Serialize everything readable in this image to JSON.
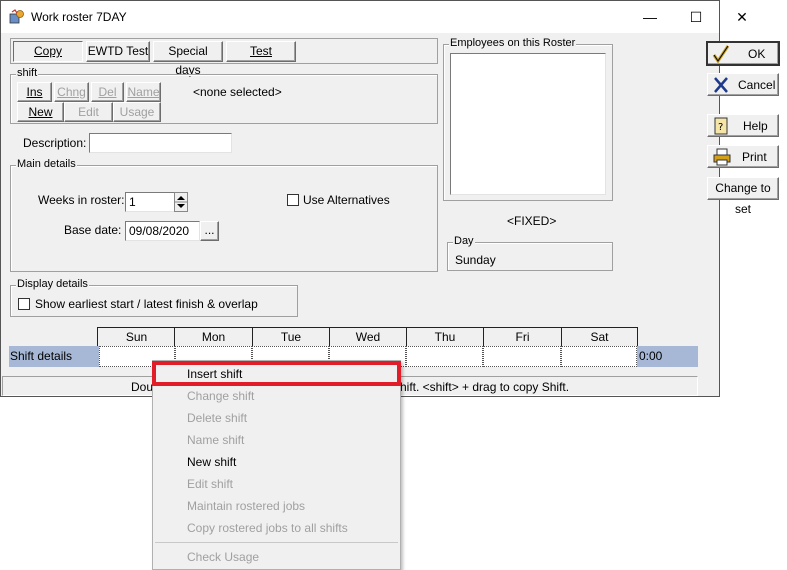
{
  "window": {
    "title": "Work roster  7DAY"
  },
  "titlebar": {
    "minimize": "—",
    "maximize": "☐",
    "close": "✕"
  },
  "tabs": {
    "copy": "Copy",
    "ewtd": "EWTD Test",
    "special_days": "Special days",
    "test": "Test"
  },
  "shift_group": {
    "label": "shift",
    "ins": "Ins",
    "chng": "Chng",
    "del": "Del",
    "name": "Name",
    "new": "New",
    "edit": "Edit",
    "usage": "Usage",
    "selection": "<none selected>"
  },
  "description": {
    "label": "Description:",
    "value": ""
  },
  "main_details": {
    "label": "Main details",
    "weeks_label": "Weeks in roster:",
    "weeks_value": "1",
    "use_alternatives": "Use Alternatives",
    "base_date_label": "Base date:",
    "base_date_value": "09/08/2020",
    "date_btn": "..."
  },
  "employees": {
    "label": "Employees on this Roster",
    "fixed": "<FIXED>"
  },
  "day": {
    "label": "Day",
    "value": "Sunday"
  },
  "display_details": {
    "label": "Display details",
    "show_overlap": "Show earliest start / latest finish & overlap"
  },
  "actions": {
    "ok": "OK",
    "cancel": "Cancel",
    "help": "Help",
    "print": "Print",
    "change_to_set": "Change to set"
  },
  "grid": {
    "days": [
      "Sun",
      "Mon",
      "Tue",
      "Wed",
      "Thu",
      "Fri",
      "Sat"
    ],
    "row_label": "Shift details",
    "total": "0:00"
  },
  "status_bar": {
    "left": "Doub",
    "right": "hift.  <shift> + drag to copy Shift."
  },
  "context_menu": {
    "items": [
      {
        "label": "Insert shift",
        "enabled": true,
        "highlighted": true
      },
      {
        "label": "Change shift",
        "enabled": false
      },
      {
        "label": "Delete shift",
        "enabled": false
      },
      {
        "label": "Name shift",
        "enabled": false
      },
      {
        "label": "New shift",
        "enabled": true
      },
      {
        "label": "Edit shift",
        "enabled": false
      },
      {
        "label": "Maintain rostered jobs",
        "enabled": false
      },
      {
        "label": "Copy rostered jobs to all shifts",
        "enabled": false
      },
      {
        "label": "Check Usage",
        "enabled": false
      }
    ]
  },
  "colors": {
    "highlight_border": "#e11d2a",
    "row_highlight": "#a6b8d6"
  }
}
